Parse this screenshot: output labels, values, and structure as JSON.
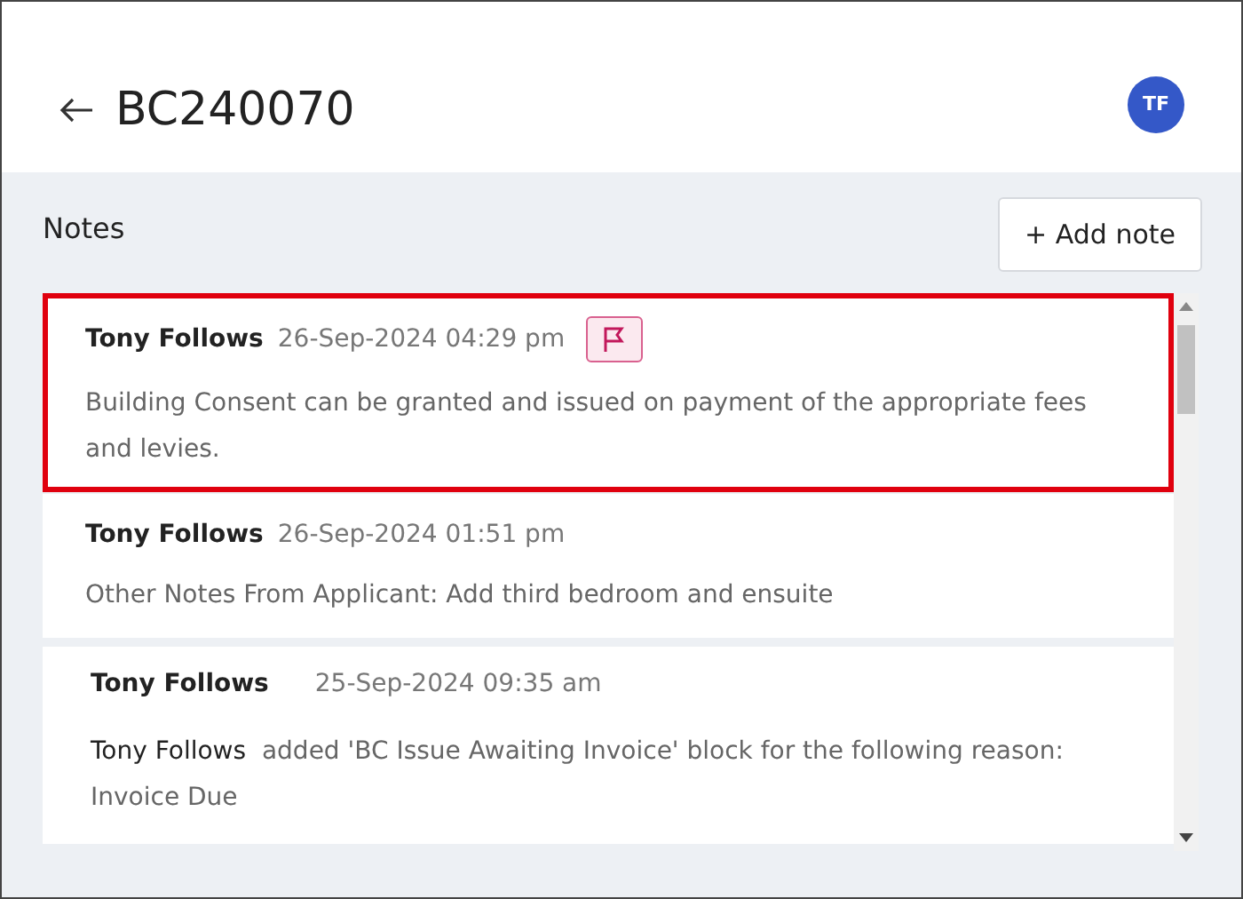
{
  "header": {
    "title": "BC240070",
    "avatar": "TF"
  },
  "notes_section": {
    "title": "Notes",
    "add_button": "+ Add note"
  },
  "notes": [
    {
      "kind": "note",
      "author": "Tony Follows",
      "timestamp": "26-Sep-2024 04:29 pm",
      "flagged": true,
      "highlighted": true,
      "body": "Building Consent can be granted and issued on payment of the appropriate fees and levies."
    },
    {
      "kind": "note",
      "author": "Tony Follows",
      "timestamp": "26-Sep-2024 01:51 pm",
      "flagged": false,
      "highlighted": false,
      "body": "Other Notes From Applicant: Add third bedroom and ensuite"
    },
    {
      "kind": "block",
      "author": "Tony Follows",
      "timestamp": "25-Sep-2024 09:35 am",
      "flagged": false,
      "highlighted": false,
      "actor": "Tony Follows",
      "body": "added 'BC Issue Awaiting Invoice' block for the following reason:",
      "reason": "Invoice Due"
    }
  ]
}
